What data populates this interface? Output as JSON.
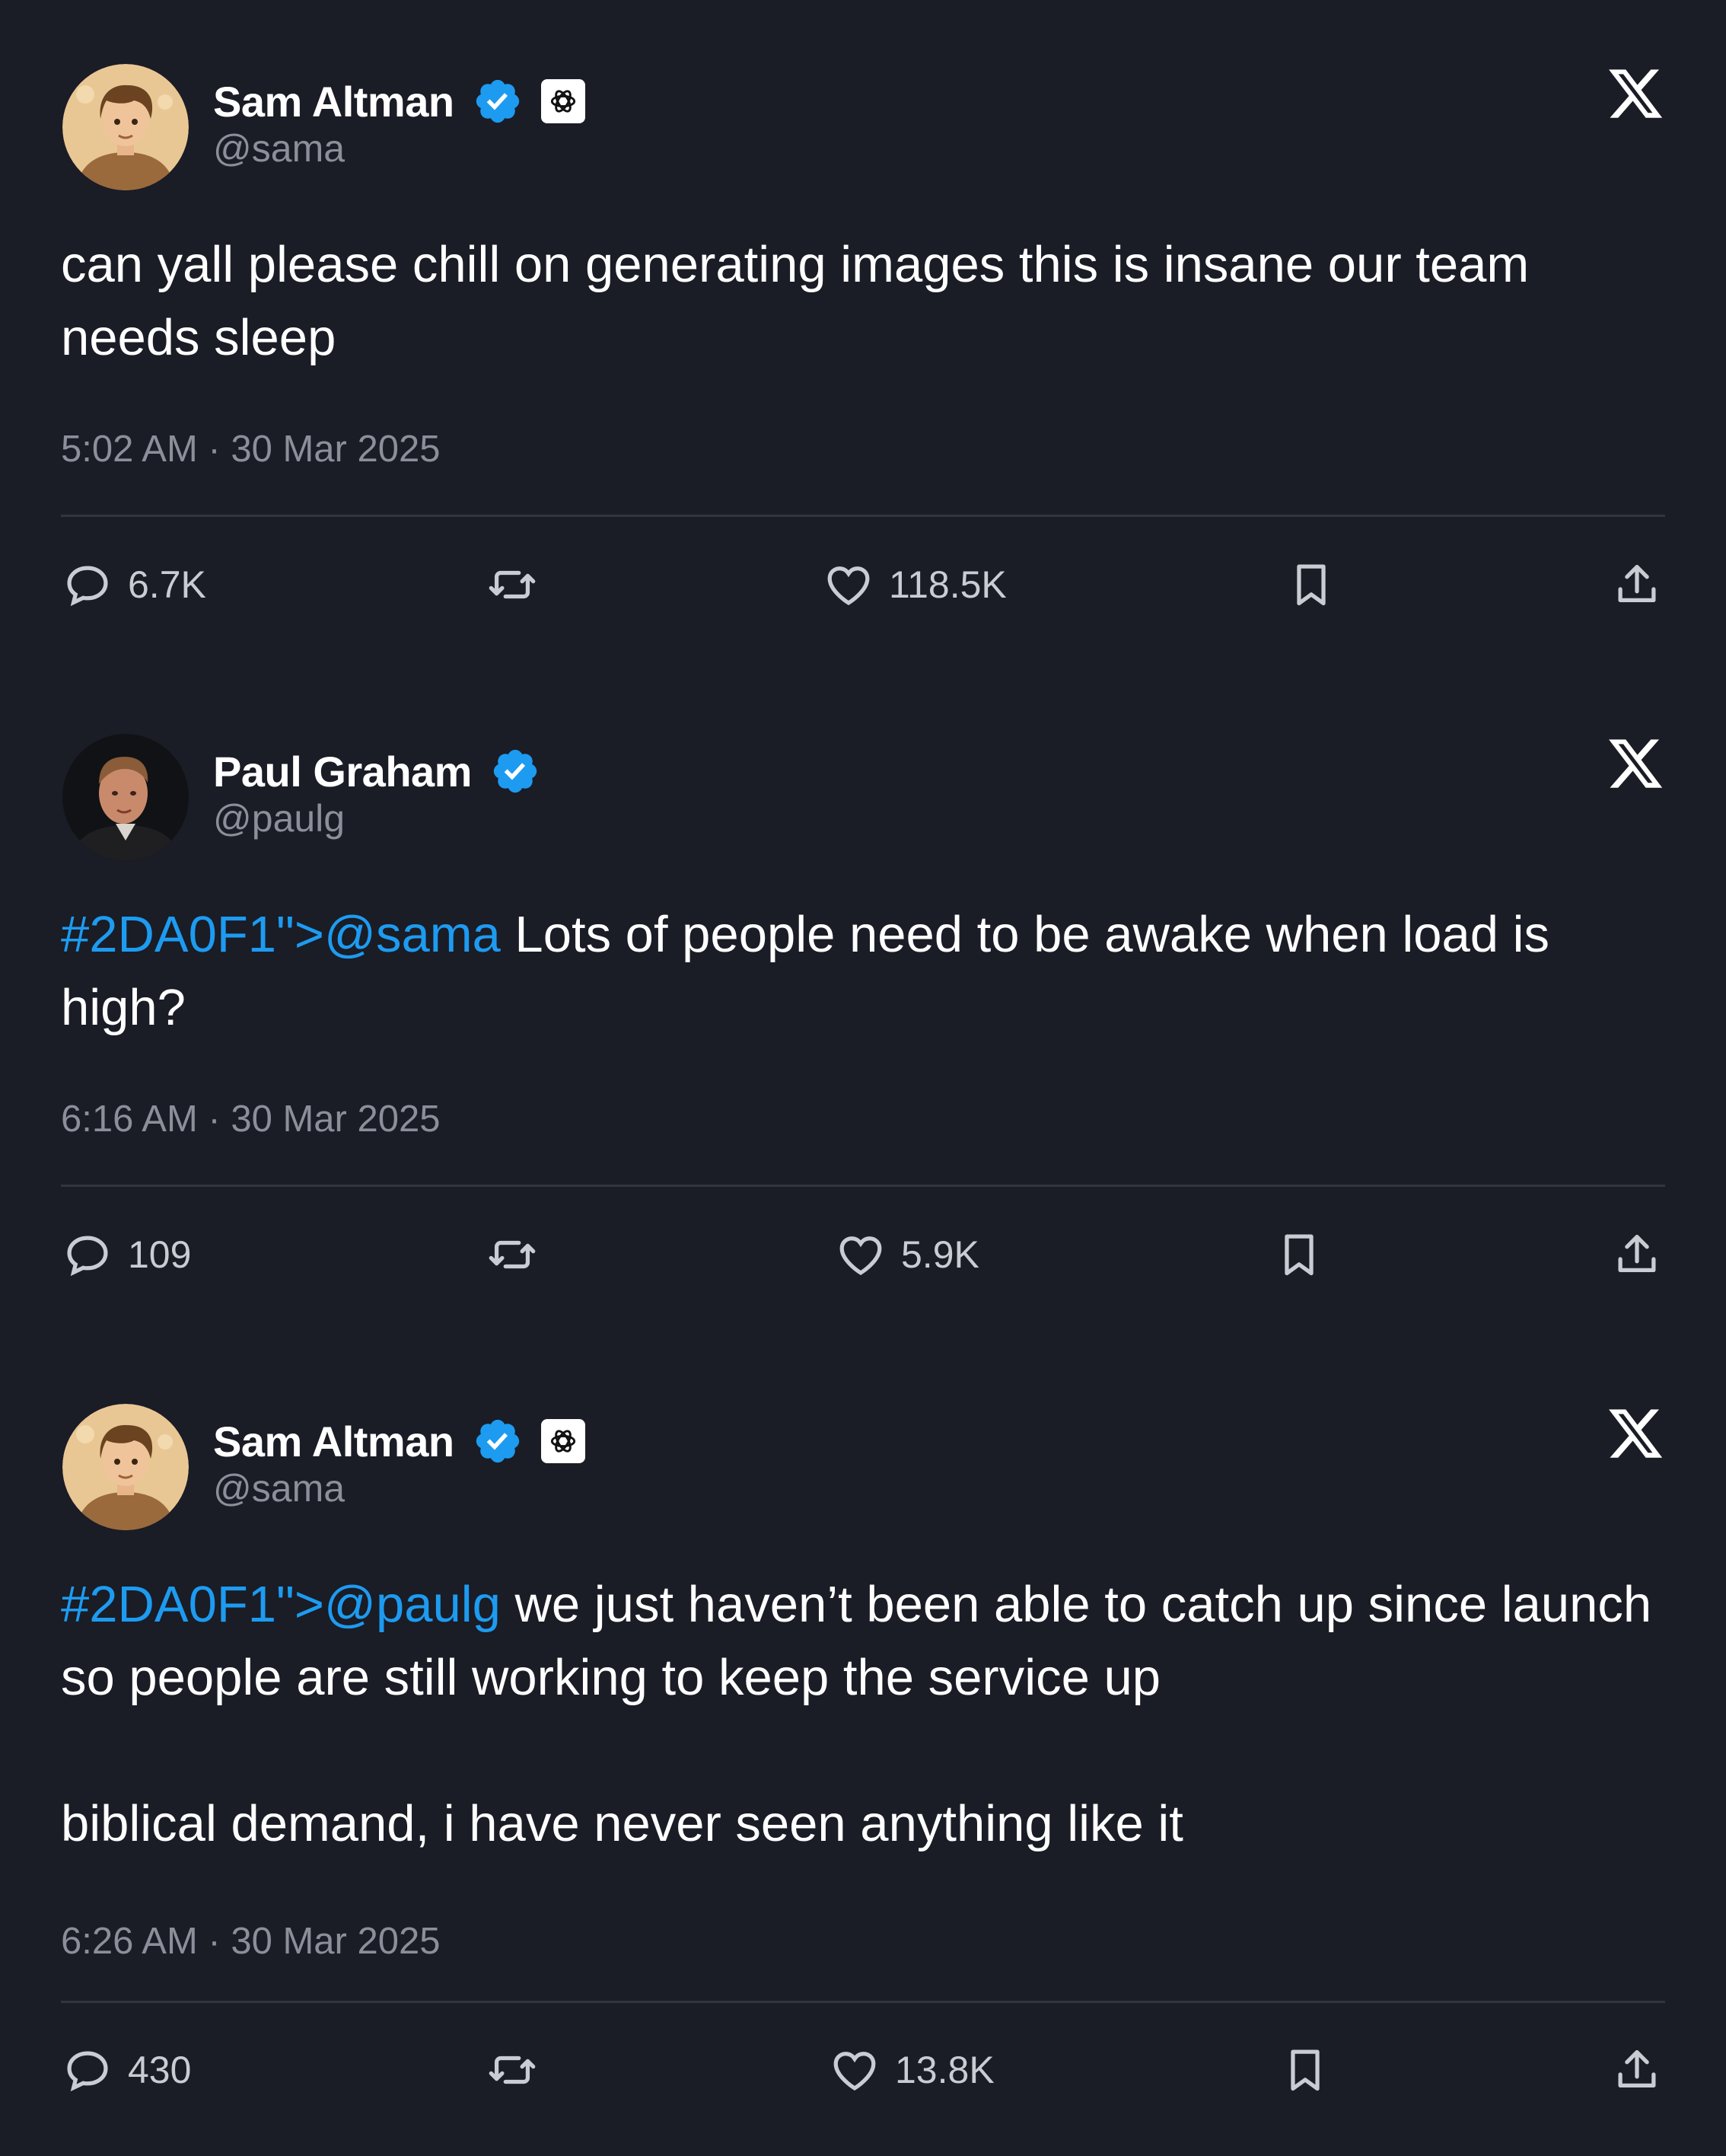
{
  "tweets": [
    {
      "display_name": "Sam Altman",
      "handle": "@sama",
      "text": "can yall please chill on generating images this is insane our team needs sleep",
      "mention": "",
      "timestamp": "5:02 AM · 30 Mar 2025",
      "replies": "6.7K",
      "likes": "118.5K",
      "avatar": "cartoon-avatar",
      "affiliate_badge": "openai-logo-icon"
    },
    {
      "display_name": "Paul Graham",
      "handle": "@paulg",
      "mention": "#2DA0F1\">@sama",
      "text": " Lots of people need to be awake when load is high?",
      "timestamp": "6:16 AM · 30 Mar 2025",
      "replies": "109",
      "likes": "5.9K",
      "avatar": "photo-avatar"
    },
    {
      "display_name": "Sam Altman",
      "handle": "@sama",
      "mention": "#2DA0F1\">@paulg",
      "text": " we just haven’t been able to catch up since launch so people are still working to keep the service up\n\nbiblical demand, i have never seen anything like it",
      "timestamp": "6:26 AM · 30 Mar 2025",
      "replies": "430",
      "likes": "13.8K",
      "avatar": "cartoon-avatar",
      "affiliate_badge": "openai-logo-icon"
    }
  ],
  "colors": {
    "background": "#1a1c26",
    "mention": "#1d9bf0",
    "verified": "#1d9bf0",
    "secondary_text": "#8b8f99",
    "divider": "#32353f"
  },
  "icons": [
    "reply-icon",
    "retweet-icon",
    "like-icon",
    "bookmark-icon",
    "share-icon",
    "x-logo-icon",
    "verified-badge-icon"
  ]
}
